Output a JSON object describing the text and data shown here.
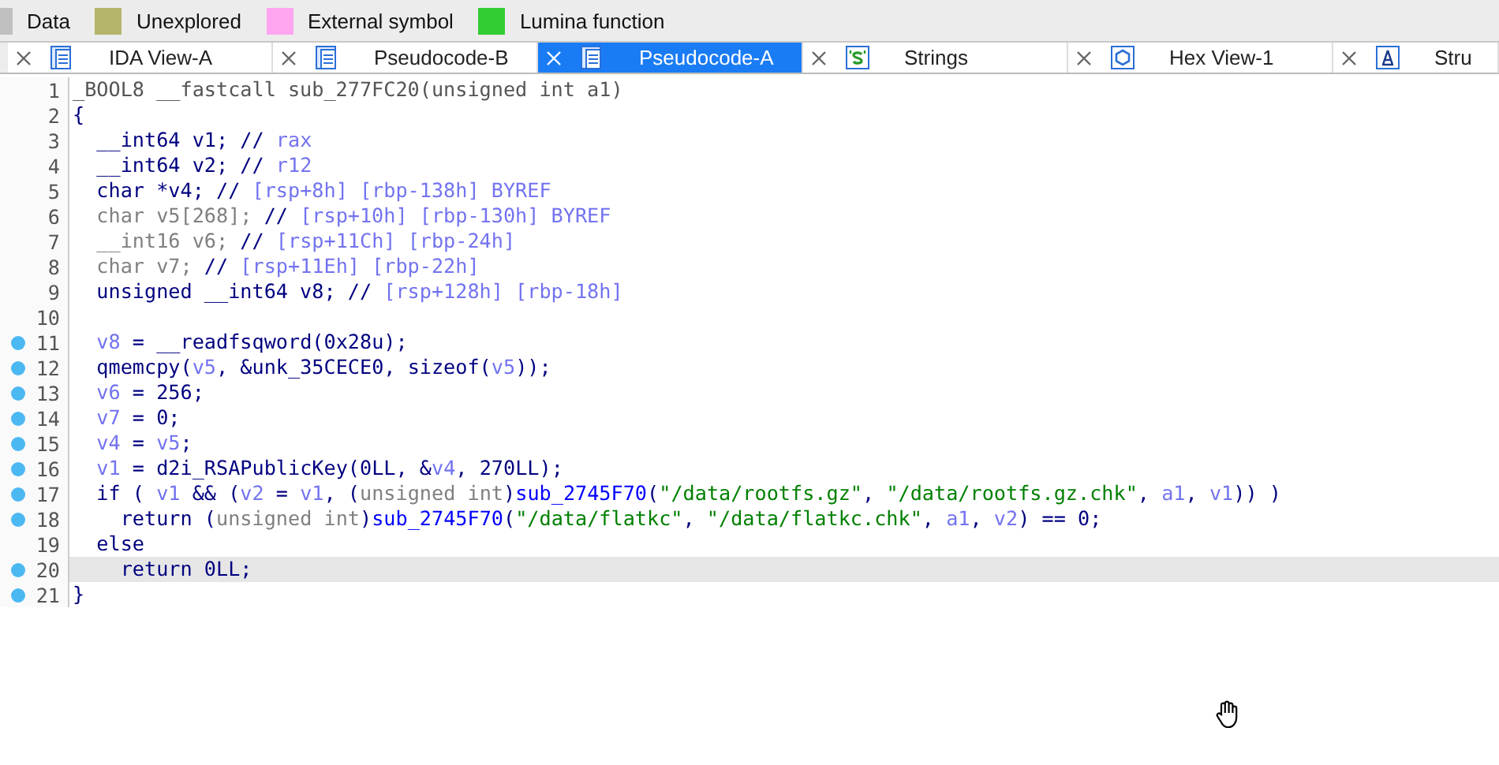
{
  "legend": [
    {
      "label": "Data",
      "color": "#c0c0c0"
    },
    {
      "label": "Unexplored",
      "color": "#b5b56b"
    },
    {
      "label": "External symbol",
      "color": "#ffa5f0"
    },
    {
      "label": "Lumina function",
      "color": "#33cc33"
    }
  ],
  "tabs": [
    {
      "label": "IDA View-A",
      "kind": "doc",
      "selected": false
    },
    {
      "label": "Pseudocode-B",
      "kind": "doc",
      "selected": false
    },
    {
      "label": "Pseudocode-A",
      "kind": "doc",
      "selected": true
    },
    {
      "label": "Strings",
      "kind": "strings",
      "selected": false
    },
    {
      "label": "Hex View-1",
      "kind": "hex",
      "selected": false
    },
    {
      "label": "Stru",
      "kind": "struct",
      "selected": false
    }
  ],
  "lines": [
    {
      "number": "1",
      "marked": false,
      "selected": false,
      "tokens": [
        {
          "kind": "decl",
          "text": "_BOOL8 __fastcall sub_277FC20(unsigned int a1)"
        }
      ]
    },
    {
      "number": "2",
      "marked": false,
      "selected": false,
      "tokens": [
        {
          "kind": "kw",
          "text": "{"
        }
      ]
    },
    {
      "number": "3",
      "marked": false,
      "selected": false,
      "tokens": [
        {
          "kind": "kw",
          "text": "  __int64 v1; //"
        },
        {
          "kind": "var",
          "text": " rax"
        }
      ]
    },
    {
      "number": "4",
      "marked": false,
      "selected": false,
      "tokens": [
        {
          "kind": "kw",
          "text": "  __int64 v2; //"
        },
        {
          "kind": "var",
          "text": " r12"
        }
      ]
    },
    {
      "number": "5",
      "marked": false,
      "selected": false,
      "tokens": [
        {
          "kind": "kw",
          "text": "  char *v4; //"
        },
        {
          "kind": "var",
          "text": " [rsp+8h] [rbp-138h] BYREF"
        }
      ]
    },
    {
      "number": "6",
      "marked": false,
      "selected": false,
      "tokens": [
        {
          "kind": "grey",
          "text": "  char v5[268];"
        },
        {
          "kind": "kw",
          "text": " //"
        },
        {
          "kind": "var",
          "text": " [rsp+10h] [rbp-130h] BYREF"
        }
      ]
    },
    {
      "number": "7",
      "marked": false,
      "selected": false,
      "tokens": [
        {
          "kind": "grey",
          "text": "  __int16 v6;"
        },
        {
          "kind": "kw",
          "text": " //"
        },
        {
          "kind": "var",
          "text": " [rsp+11Ch] [rbp-24h]"
        }
      ]
    },
    {
      "number": "8",
      "marked": false,
      "selected": false,
      "tokens": [
        {
          "kind": "grey",
          "text": "  char v7;"
        },
        {
          "kind": "kw",
          "text": " //"
        },
        {
          "kind": "var",
          "text": " [rsp+11Eh] [rbp-22h]"
        }
      ]
    },
    {
      "number": "9",
      "marked": false,
      "selected": false,
      "tokens": [
        {
          "kind": "kw",
          "text": "  unsigned __int64 v8; //"
        },
        {
          "kind": "var",
          "text": " [rsp+128h] [rbp-18h]"
        }
      ]
    },
    {
      "number": "10",
      "marked": false,
      "selected": false
    },
    {
      "number": "11",
      "marked": true,
      "selected": false,
      "tokens": [
        {
          "kind": "var",
          "text": "  v8"
        },
        {
          "kind": "kw",
          "text": " = __readfsqword(0x28u);"
        }
      ]
    },
    {
      "number": "12",
      "marked": true,
      "selected": false,
      "tokens": [
        {
          "kind": "kw",
          "text": "  qmemcpy("
        },
        {
          "kind": "var",
          "text": "v5"
        },
        {
          "kind": "kw",
          "text": ", &unk_35CECE0, sizeof("
        },
        {
          "kind": "var",
          "text": "v5"
        },
        {
          "kind": "kw",
          "text": "));"
        }
      ]
    },
    {
      "number": "13",
      "marked": true,
      "selected": false,
      "tokens": [
        {
          "kind": "var",
          "text": "  v6"
        },
        {
          "kind": "kw",
          "text": " = 256;"
        }
      ]
    },
    {
      "number": "14",
      "marked": true,
      "selected": false,
      "tokens": [
        {
          "kind": "var",
          "text": "  v7"
        },
        {
          "kind": "kw",
          "text": " = 0;"
        }
      ]
    },
    {
      "number": "15",
      "marked": true,
      "selected": false,
      "tokens": [
        {
          "kind": "var",
          "text": "  v4"
        },
        {
          "kind": "kw",
          "text": " = "
        },
        {
          "kind": "var",
          "text": "v5"
        },
        {
          "kind": "kw",
          "text": ";"
        }
      ]
    },
    {
      "number": "16",
      "marked": true,
      "selected": false,
      "tokens": [
        {
          "kind": "var",
          "text": "  v1"
        },
        {
          "kind": "kw",
          "text": " = d2i_RSAPublicKey(0LL, &"
        },
        {
          "kind": "var",
          "text": "v4"
        },
        {
          "kind": "kw",
          "text": ", 270LL);"
        }
      ]
    },
    {
      "number": "17",
      "marked": true,
      "selected": false,
      "tokens": [
        {
          "kind": "kw",
          "text": "  if ( "
        },
        {
          "kind": "var",
          "text": "v1"
        },
        {
          "kind": "kw",
          "text": " && ("
        },
        {
          "kind": "var",
          "text": "v2"
        },
        {
          "kind": "kw",
          "text": " = "
        },
        {
          "kind": "var",
          "text": "v1"
        },
        {
          "kind": "kw",
          "text": ", ("
        },
        {
          "kind": "grey",
          "text": "unsigned int"
        },
        {
          "kind": "kw",
          "text": ")"
        },
        {
          "kind": "func",
          "text": "sub_2745F70"
        },
        {
          "kind": "kw",
          "text": "("
        },
        {
          "kind": "str",
          "text": "\"/data/rootfs.gz\""
        },
        {
          "kind": "kw",
          "text": ", "
        },
        {
          "kind": "str",
          "text": "\"/data/rootfs.gz.chk\""
        },
        {
          "kind": "kw",
          "text": ", "
        },
        {
          "kind": "var",
          "text": "a1"
        },
        {
          "kind": "kw",
          "text": ", "
        },
        {
          "kind": "var",
          "text": "v1"
        },
        {
          "kind": "kw",
          "text": ")) )"
        }
      ]
    },
    {
      "number": "18",
      "marked": true,
      "selected": false,
      "tokens": [
        {
          "kind": "kw",
          "text": "    return ("
        },
        {
          "kind": "grey",
          "text": "unsigned int"
        },
        {
          "kind": "kw",
          "text": ")"
        },
        {
          "kind": "func",
          "text": "sub_2745F70"
        },
        {
          "kind": "kw",
          "text": "("
        },
        {
          "kind": "str",
          "text": "\"/data/flatkc\""
        },
        {
          "kind": "kw",
          "text": ", "
        },
        {
          "kind": "str",
          "text": "\"/data/flatkc.chk\""
        },
        {
          "kind": "kw",
          "text": ", "
        },
        {
          "kind": "var",
          "text": "a1"
        },
        {
          "kind": "kw",
          "text": ", "
        },
        {
          "kind": "var",
          "text": "v2"
        },
        {
          "kind": "kw",
          "text": ") == 0;"
        }
      ]
    },
    {
      "number": "19",
      "marked": false,
      "selected": false,
      "tokens": [
        {
          "kind": "kw",
          "text": "  else"
        }
      ]
    },
    {
      "number": "20",
      "marked": true,
      "selected": true,
      "tokens": [
        {
          "kind": "kw",
          "text": "    return 0LL;"
        }
      ]
    },
    {
      "number": "21",
      "marked": true,
      "selected": false,
      "tokens": [
        {
          "kind": "kw",
          "text": "}"
        }
      ]
    }
  ]
}
